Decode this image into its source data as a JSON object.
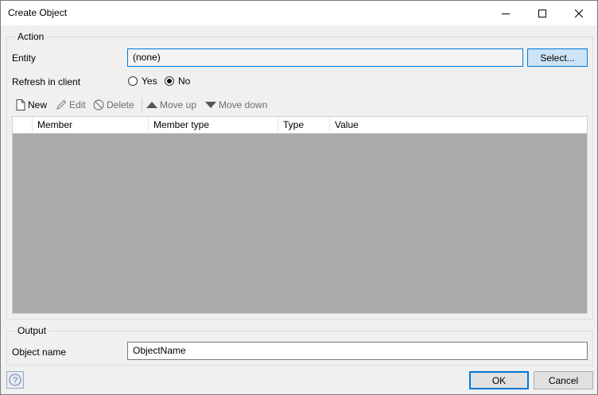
{
  "window": {
    "title": "Create Object"
  },
  "action": {
    "legend": "Action",
    "entity_label": "Entity",
    "entity_value": "(none)",
    "select_button": "Select...",
    "refresh_label": "Refresh in client",
    "refresh_options": [
      {
        "label": "Yes",
        "checked": false
      },
      {
        "label": "No",
        "checked": true
      }
    ]
  },
  "toolbar": {
    "new": "New",
    "edit": "Edit",
    "delete": "Delete",
    "move_up": "Move up",
    "move_down": "Move down"
  },
  "grid": {
    "columns": [
      "Member",
      "Member type",
      "Type",
      "Value"
    ],
    "rows": []
  },
  "output": {
    "legend": "Output",
    "object_name_label": "Object name",
    "object_name_value": "ObjectName"
  },
  "footer": {
    "ok": "OK",
    "cancel": "Cancel"
  },
  "colors": {
    "accent": "#0078d7",
    "select_button_bg": "#cce4f7",
    "grid_empty_bg": "#ababab"
  },
  "icons": [
    "minimize-icon",
    "maximize-icon",
    "close-icon",
    "new-document-icon",
    "pencil-icon",
    "delete-icon",
    "triangle-up-icon",
    "triangle-down-icon",
    "help-icon"
  ]
}
